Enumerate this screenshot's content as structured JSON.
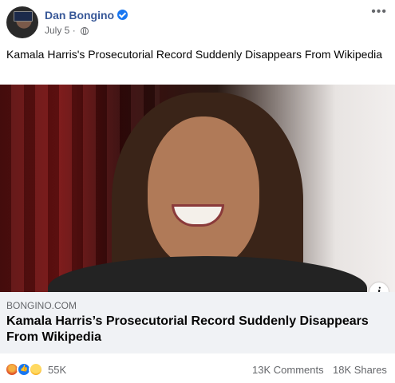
{
  "post": {
    "author": "Dan Bongino",
    "date": "July 5",
    "separator": "·",
    "caption": "Kamala Harris's Prosecutorial Record Suddenly Disappears From Wikipedia",
    "more_icon": "•••"
  },
  "link": {
    "domain": "BONGINO.COM",
    "title": "Kamala Harris’s Prosecutorial Record Suddenly Disappears From Wikipedia",
    "info_icon": "i"
  },
  "footer": {
    "reactions": [
      "angry",
      "like",
      "haha"
    ],
    "reaction_count": "55K",
    "comments": "13K Comments",
    "shares": "18K Shares"
  },
  "colors": {
    "author": "#385898",
    "verified": "#1877f2",
    "link_bg": "#f0f2f5",
    "muted": "#65676b"
  }
}
